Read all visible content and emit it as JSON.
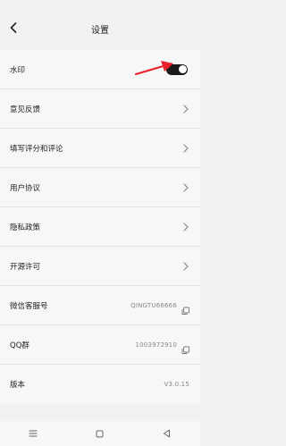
{
  "header": {
    "title": "设置",
    "back_icon": "chevron-left-icon"
  },
  "settings": [
    {
      "id": "watermark",
      "label": "水印",
      "control": "toggle",
      "enabled": true
    },
    {
      "id": "feedback",
      "label": "意见反馈",
      "control": "chevron"
    },
    {
      "id": "rate",
      "label": "填写评分和评论",
      "control": "chevron"
    },
    {
      "id": "user-agreement",
      "label": "用户协议",
      "control": "chevron"
    },
    {
      "id": "privacy",
      "label": "隐私政策",
      "control": "chevron"
    },
    {
      "id": "open-source",
      "label": "开源许可",
      "control": "chevron"
    },
    {
      "id": "wechat",
      "label": "微信客服号",
      "value": "QINGTU66666",
      "control": "copy"
    },
    {
      "id": "qq",
      "label": "QQ群",
      "value": "1003972910",
      "control": "copy"
    },
    {
      "id": "version",
      "label": "版本",
      "value": "V3.0.15",
      "control": "none"
    }
  ],
  "colors": {
    "toggle_on": "#1a1a1a",
    "annotation_arrow": "#e8202a",
    "background": "#f2f2f2",
    "row_bg": "#f7f7f7"
  },
  "system_nav": [
    "menu-icon",
    "home-icon",
    "back-triangle-icon"
  ]
}
